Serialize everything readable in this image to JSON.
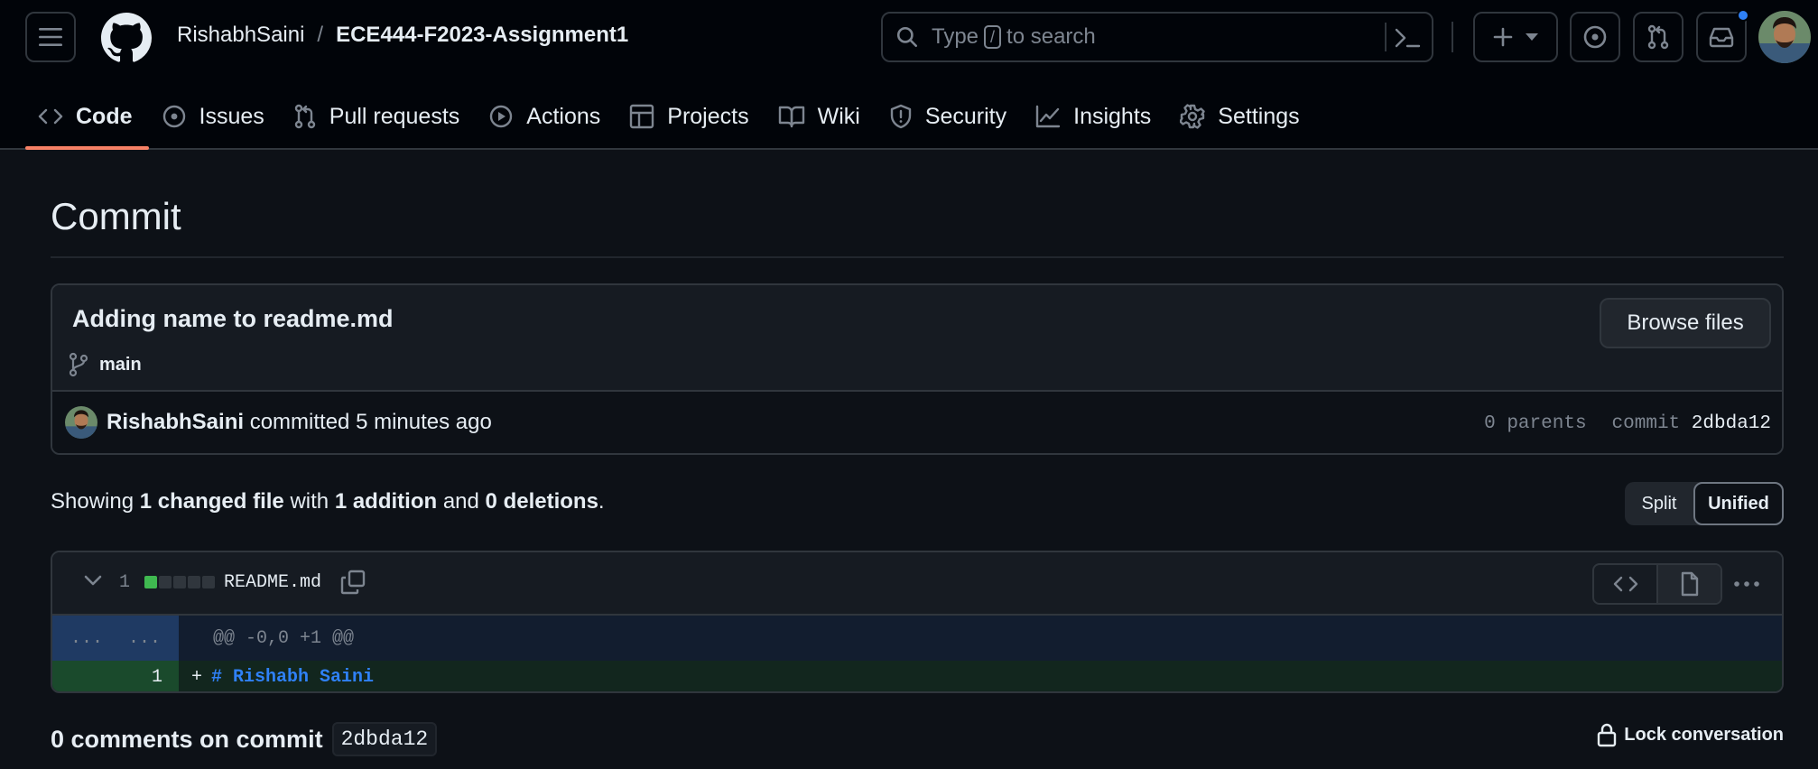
{
  "header": {
    "owner": "RishabhSaini",
    "separator": "/",
    "repo": "ECE444-F2023-Assignment1",
    "search_prefix": "Type",
    "search_key": "/",
    "search_suffix": "to search"
  },
  "tabs": [
    {
      "label": "Code",
      "icon": "code-icon",
      "active": true
    },
    {
      "label": "Issues",
      "icon": "issue-icon"
    },
    {
      "label": "Pull requests",
      "icon": "pull-request-icon"
    },
    {
      "label": "Actions",
      "icon": "play-icon"
    },
    {
      "label": "Projects",
      "icon": "table-icon"
    },
    {
      "label": "Wiki",
      "icon": "book-icon"
    },
    {
      "label": "Security",
      "icon": "shield-icon"
    },
    {
      "label": "Insights",
      "icon": "graph-icon"
    },
    {
      "label": "Settings",
      "icon": "gear-icon"
    }
  ],
  "page": {
    "title": "Commit"
  },
  "commit": {
    "message": "Adding name to readme.md",
    "branch": "main",
    "browse_label": "Browse files",
    "author": "RishabhSaini",
    "action": "committed",
    "time": "5 minutes ago",
    "parents": "0 parents",
    "commit_label": "commit",
    "sha": "2dbda12"
  },
  "summary": {
    "prefix": "Showing",
    "files": "1 changed file",
    "with": "with",
    "additions": "1 addition",
    "and": "and",
    "deletions": "0 deletions",
    "end": "."
  },
  "view_toggle": {
    "split": "Split",
    "unified": "Unified",
    "selected": "Unified"
  },
  "diff": {
    "count": "1",
    "file": "README.md",
    "stat": [
      "add",
      "neutral",
      "neutral",
      "neutral",
      "neutral"
    ],
    "hunk_gutter_left": "...",
    "hunk_gutter_right": "...",
    "hunk_header": "@@ -0,0 +1 @@",
    "line_number": "1",
    "line_sign": "+",
    "line_code": "# Rishabh Saini"
  },
  "comments": {
    "title": "0 comments on commit",
    "sha": "2dbda12",
    "lock_label": "Lock conversation"
  },
  "colors": {
    "background": "#0d1117",
    "header": "#010409",
    "accent_tab": "#f78166",
    "addition": "#3fb950",
    "link": "#2f81f7"
  }
}
